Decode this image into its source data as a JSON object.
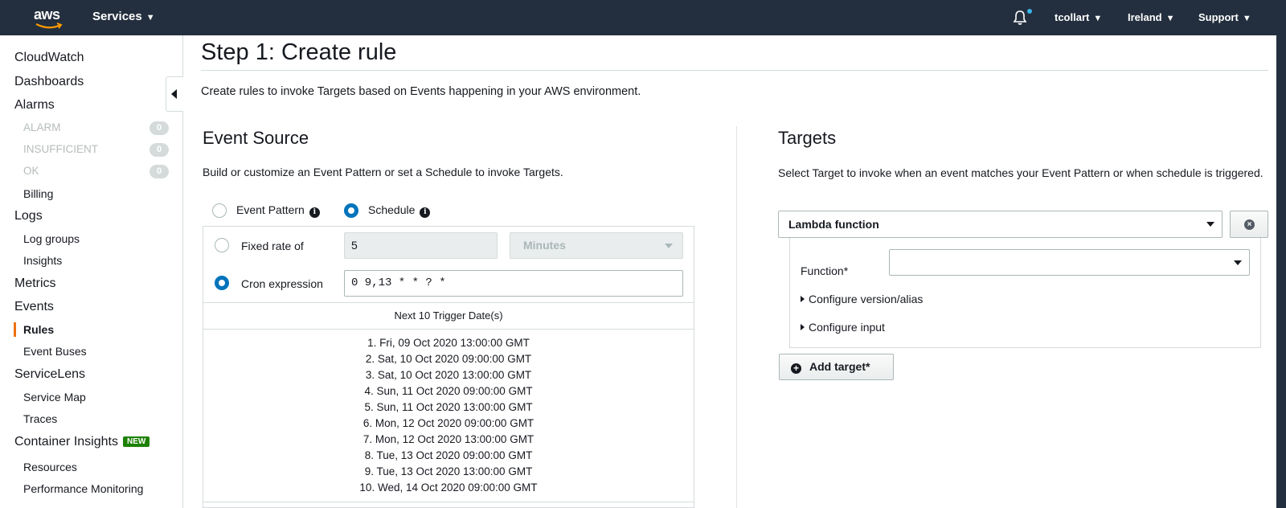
{
  "topbar": {
    "logo": "aws",
    "services": "Services",
    "user": "tcollart",
    "region": "Ireland",
    "support": "Support",
    "notification_icon": "bell-icon"
  },
  "sidebar": {
    "cloudwatch": "CloudWatch",
    "dashboards": "Dashboards",
    "alarms": "Alarms",
    "alarm": "ALARM",
    "alarm_count": "0",
    "insufficient": "INSUFFICIENT",
    "insufficient_count": "0",
    "ok": "OK",
    "ok_count": "0",
    "billing": "Billing",
    "logs": "Logs",
    "log_groups": "Log groups",
    "insights": "Insights",
    "metrics": "Metrics",
    "events": "Events",
    "rules": "Rules",
    "event_buses": "Event Buses",
    "servicelens": "ServiceLens",
    "service_map": "Service Map",
    "traces": "Traces",
    "container_insights": "Container Insights",
    "new_badge": "NEW",
    "resources": "Resources",
    "performance_monitoring": "Performance Monitoring",
    "active_color": "#ec7211"
  },
  "main": {
    "title": "Step 1: Create rule",
    "description": "Create rules to invoke Targets based on Events happening in your AWS environment.",
    "event_source": {
      "heading": "Event Source",
      "description": "Build or customize an Event Pattern or set a Schedule to invoke Targets.",
      "event_pattern_label": "Event Pattern",
      "schedule_label": "Schedule",
      "selected_mode": "Schedule",
      "fixed_rate_label": "Fixed rate of",
      "fixed_rate_value": "5",
      "fixed_rate_unit": "Minutes",
      "cron_label": "Cron expression",
      "cron_value": "0 9,13 * * ? *",
      "selected_schedule": "Cron expression",
      "next_triggers_heading": "Next 10 Trigger Date(s)",
      "triggers": [
        "1. Fri, 09 Oct 2020 13:00:00 GMT",
        "2. Sat, 10 Oct 2020 09:00:00 GMT",
        "3. Sat, 10 Oct 2020 13:00:00 GMT",
        "4. Sun, 11 Oct 2020 09:00:00 GMT",
        "5. Sun, 11 Oct 2020 13:00:00 GMT",
        "6. Mon, 12 Oct 2020 09:00:00 GMT",
        "7. Mon, 12 Oct 2020 13:00:00 GMT",
        "8. Tue, 13 Oct 2020 09:00:00 GMT",
        "9. Tue, 13 Oct 2020 13:00:00 GMT",
        "10. Wed, 14 Oct 2020 09:00:00 GMT"
      ]
    },
    "targets": {
      "heading": "Targets",
      "description": "Select Target to invoke when an event matches your Event Pattern or when schedule is triggered.",
      "target_type": "Lambda function",
      "function_label": "Function*",
      "function_value": "",
      "configure_version": "Configure version/alias",
      "configure_input": "Configure input",
      "add_target": "Add target*"
    }
  },
  "colors": {
    "nav_bg": "#232f3e",
    "radio_selected": "#0073bb",
    "new_badge": "#1d8102"
  }
}
